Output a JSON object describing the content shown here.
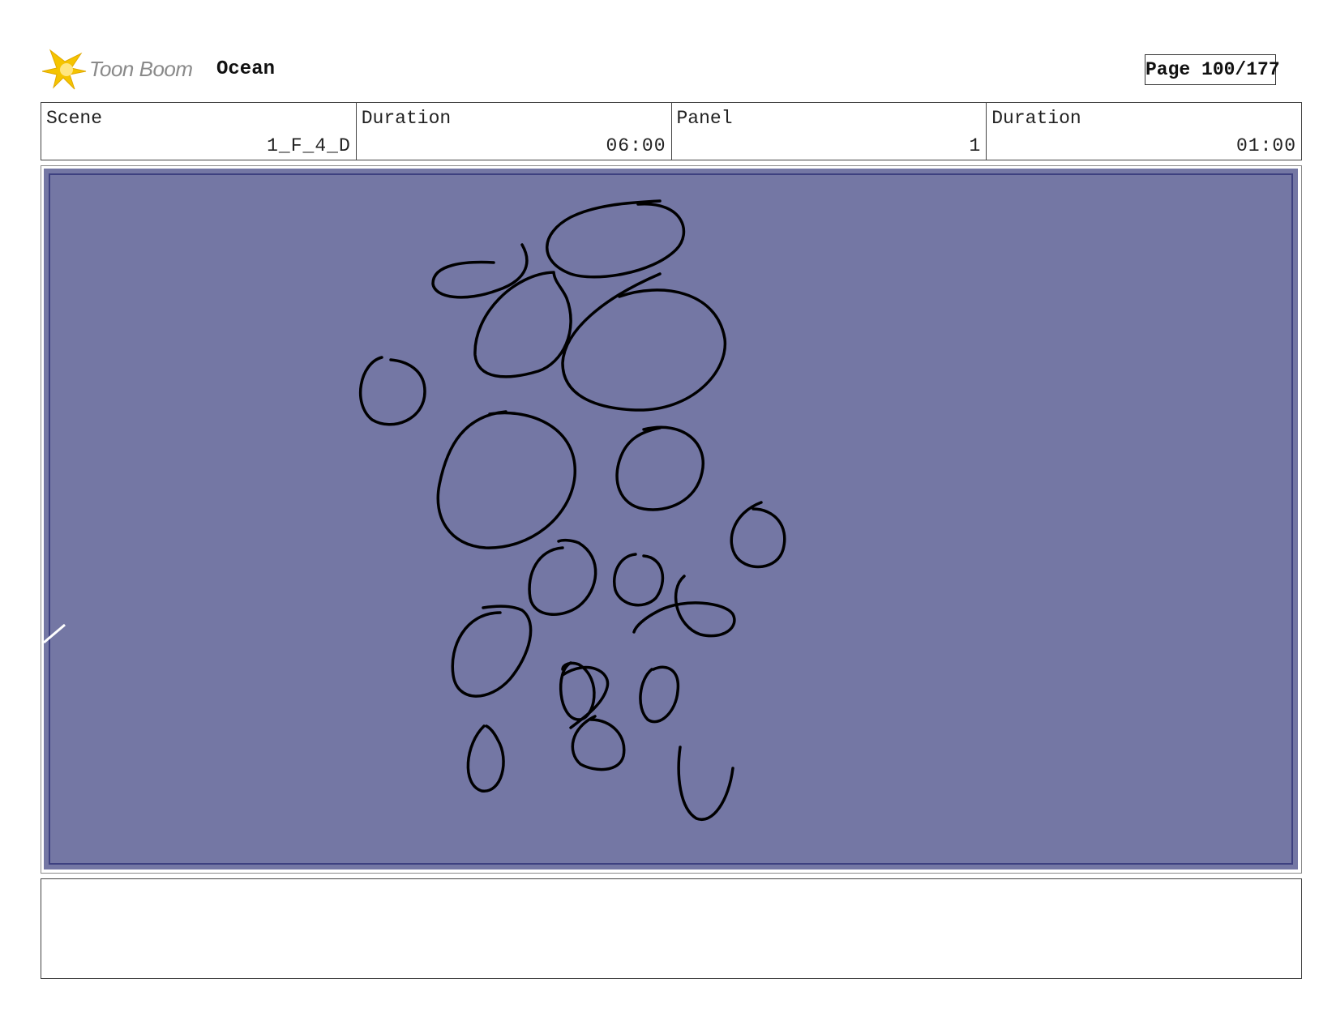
{
  "header": {
    "logo_text": "Toon Boom",
    "project_title": "Ocean",
    "page_label": "Page 100/177"
  },
  "info": {
    "scene_label": "Scene",
    "scene_value": "1_F_4_D",
    "scene_duration_label": "Duration",
    "scene_duration_value": "06:00",
    "panel_label": "Panel",
    "panel_value": "1",
    "panel_duration_label": "Duration",
    "panel_duration_value": "01:00"
  },
  "panel": {
    "background_color": "#7477a4",
    "sketch": "bubble-circles-sketch"
  },
  "notes": {
    "text": ""
  },
  "colors": {
    "logo_star": "#f5c400",
    "logo_text": "#8a8a8a",
    "panel_fill": "#7477a4",
    "panel_inner_border": "#3d4080"
  }
}
